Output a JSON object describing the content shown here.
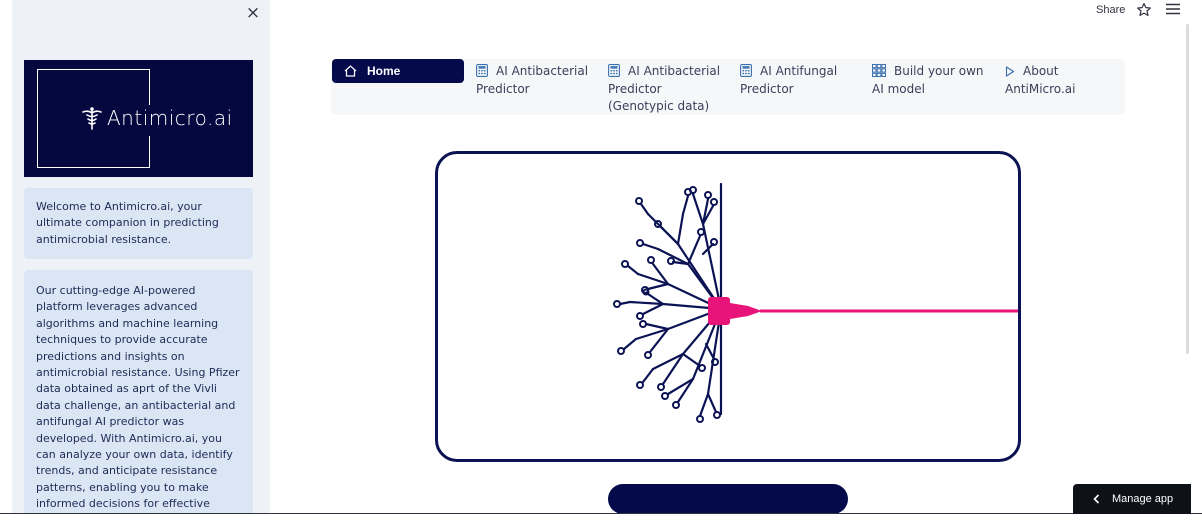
{
  "sidebar": {
    "close_label": "×",
    "logo_text": "Antimicro.ai",
    "welcome_text": "Welcome to Antimicro.ai, your ultimate companion in predicting antimicrobial resistance.",
    "description_text": "Our cutting-edge AI-powered platform leverages advanced algorithms and machine learning techniques to provide accurate predictions and insights on antimicrobial resistance. Using Pfizer data obtained as aprt of the Vivli data challenge, an antibacterial and antifungal AI predictor was developed. With Antimicro.ai, you can analyze your own data, identify trends, and anticipate resistance patterns, enabling you to make informed decisions for effective treatment strategies. Whether you're a healthcare professional,"
  },
  "topbar": {
    "share_label": "Share",
    "star_icon": "star-icon",
    "menu_icon": "menu-icon"
  },
  "nav": {
    "items": [
      {
        "label": "Home",
        "icon": "house-icon"
      },
      {
        "label": "AI Antibacterial Predictor",
        "icon": "calculator-icon"
      },
      {
        "label": "AI Antibacterial Predictor (Genotypic data)",
        "icon": "calculator-icon"
      },
      {
        "label": "AI Antifungal Predictor",
        "icon": "calculator-icon"
      },
      {
        "label": "Build your own AI model",
        "icon": "grid-icon"
      },
      {
        "label": "About AntiMicro.ai",
        "icon": "play-icon"
      }
    ]
  },
  "hero": {
    "graphic": "circuit-brain-illustration",
    "accent_color": "#e8147a",
    "brand_color": "#050a4a"
  },
  "manage_app": {
    "label": "Manage app",
    "icon": "chevron-left-icon"
  }
}
